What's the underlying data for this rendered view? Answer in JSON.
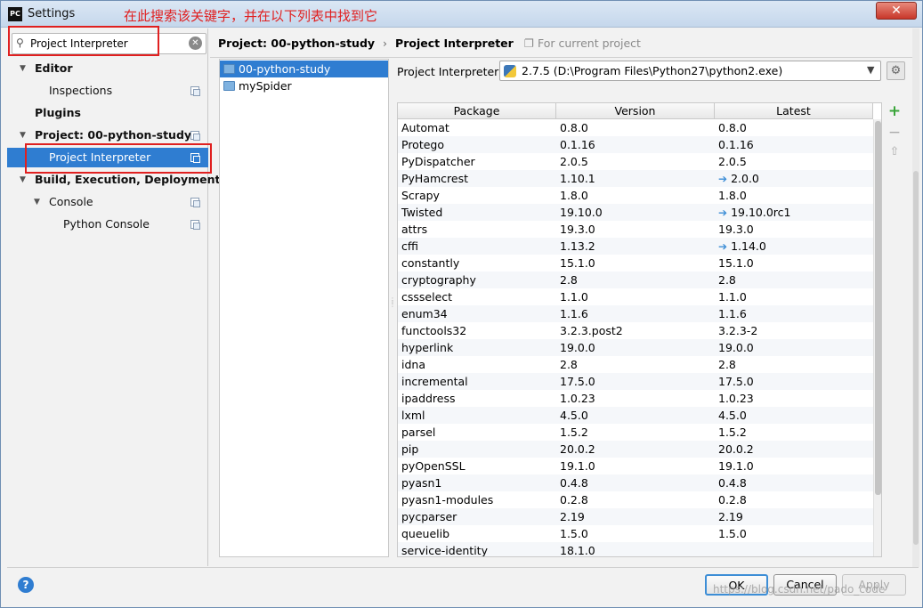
{
  "window": {
    "title": "Settings",
    "app_icon": "PC",
    "annotation": "在此搜索该关键字，并在以下列表中找到它",
    "close": "✕"
  },
  "search": {
    "value": "Project Interpreter",
    "clear": "✕"
  },
  "tree": {
    "editor": "Editor",
    "inspections": "Inspections",
    "plugins": "Plugins",
    "project": "Project: 00-python-study",
    "project_interpreter": "Project Interpreter",
    "build": "Build, Execution, Deployment",
    "console": "Console",
    "python_console": "Python Console"
  },
  "breadcrumb": {
    "project": "Project: 00-python-study",
    "separator": "›",
    "page": "Project Interpreter",
    "scope": "For current project"
  },
  "projects": [
    "00-python-study",
    "mySpider"
  ],
  "interpreter": {
    "label": "Project Interpreter:",
    "value": "2.7.5 (D:\\Program Files\\Python27\\python2.exe)"
  },
  "table": {
    "headers": {
      "package": "Package",
      "version": "Version",
      "latest": "Latest"
    },
    "rows": [
      {
        "package": "Automat",
        "version": "0.8.0",
        "latest": "0.8.0",
        "upgrade": false
      },
      {
        "package": "Protego",
        "version": "0.1.16",
        "latest": "0.1.16",
        "upgrade": false
      },
      {
        "package": "PyDispatcher",
        "version": "2.0.5",
        "latest": "2.0.5",
        "upgrade": false
      },
      {
        "package": "PyHamcrest",
        "version": "1.10.1",
        "latest": "2.0.0",
        "upgrade": true
      },
      {
        "package": "Scrapy",
        "version": "1.8.0",
        "latest": "1.8.0",
        "upgrade": false
      },
      {
        "package": "Twisted",
        "version": "19.10.0",
        "latest": "19.10.0rc1",
        "upgrade": true
      },
      {
        "package": "attrs",
        "version": "19.3.0",
        "latest": "19.3.0",
        "upgrade": false
      },
      {
        "package": "cffi",
        "version": "1.13.2",
        "latest": "1.14.0",
        "upgrade": true
      },
      {
        "package": "constantly",
        "version": "15.1.0",
        "latest": "15.1.0",
        "upgrade": false
      },
      {
        "package": "cryptography",
        "version": "2.8",
        "latest": "2.8",
        "upgrade": false
      },
      {
        "package": "cssselect",
        "version": "1.1.0",
        "latest": "1.1.0",
        "upgrade": false
      },
      {
        "package": "enum34",
        "version": "1.1.6",
        "latest": "1.1.6",
        "upgrade": false
      },
      {
        "package": "functools32",
        "version": "3.2.3.post2",
        "latest": "3.2.3-2",
        "upgrade": false
      },
      {
        "package": "hyperlink",
        "version": "19.0.0",
        "latest": "19.0.0",
        "upgrade": false
      },
      {
        "package": "idna",
        "version": "2.8",
        "latest": "2.8",
        "upgrade": false
      },
      {
        "package": "incremental",
        "version": "17.5.0",
        "latest": "17.5.0",
        "upgrade": false
      },
      {
        "package": "ipaddress",
        "version": "1.0.23",
        "latest": "1.0.23",
        "upgrade": false
      },
      {
        "package": "lxml",
        "version": "4.5.0",
        "latest": "4.5.0",
        "upgrade": false
      },
      {
        "package": "parsel",
        "version": "1.5.2",
        "latest": "1.5.2",
        "upgrade": false
      },
      {
        "package": "pip",
        "version": "20.0.2",
        "latest": "20.0.2",
        "upgrade": false
      },
      {
        "package": "pyOpenSSL",
        "version": "19.1.0",
        "latest": "19.1.0",
        "upgrade": false
      },
      {
        "package": "pyasn1",
        "version": "0.4.8",
        "latest": "0.4.8",
        "upgrade": false
      },
      {
        "package": "pyasn1-modules",
        "version": "0.2.8",
        "latest": "0.2.8",
        "upgrade": false
      },
      {
        "package": "pycparser",
        "version": "2.19",
        "latest": "2.19",
        "upgrade": false
      },
      {
        "package": "queuelib",
        "version": "1.5.0",
        "latest": "1.5.0",
        "upgrade": false
      },
      {
        "package": "service-identity",
        "version": "18.1.0",
        "latest": "",
        "upgrade": false
      }
    ]
  },
  "tools": {
    "add": "+",
    "remove": "−",
    "upgrade": "⇧"
  },
  "buttons": {
    "help": "?",
    "ok": "OK",
    "cancel": "Cancel",
    "apply": "Apply"
  },
  "watermark": "https://blog.csdn.net/pado_code",
  "colors": {
    "selection": "#2f7dd1",
    "annotation": "#e02020",
    "upgrade_arrow": "#3d8ed6"
  }
}
